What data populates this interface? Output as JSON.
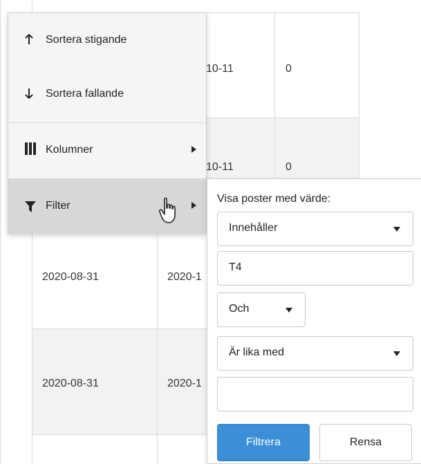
{
  "grid": {
    "rows": [
      {
        "col3": "10-11",
        "col4": "0"
      },
      {
        "col3": "10-11",
        "col4": "0"
      },
      {
        "col2": "2020-08-31",
        "col3": "2020-1"
      },
      {
        "col2": "2020-08-31",
        "col3": "2020-1"
      }
    ]
  },
  "menu": {
    "sort_asc": "Sortera stigande",
    "sort_desc": "Sortera fallande",
    "columns": "Kolumner",
    "filter": "Filter"
  },
  "filter_panel": {
    "title": "Visa poster med värde:",
    "operator1": "Innehåller",
    "value1": "T4",
    "logic": "Och",
    "operator2": "Är lika med",
    "value2": "",
    "filter_button": "Filtrera",
    "clear_button": "Rensa"
  },
  "colors": {
    "primary": "#3b8fd6",
    "menu_bg": "#f5f5f5",
    "active_bg": "#d7d7d7"
  }
}
